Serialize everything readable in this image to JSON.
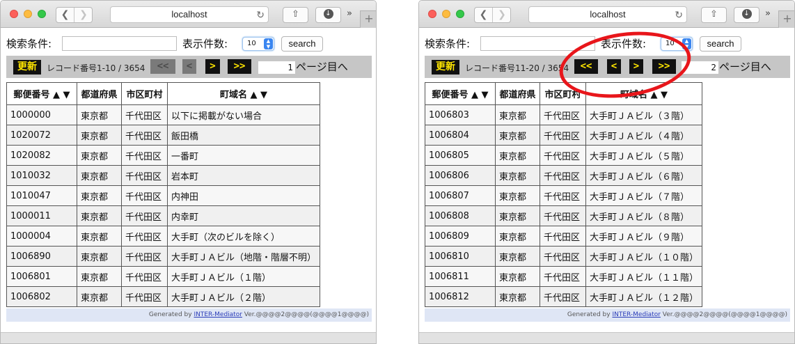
{
  "accent_colors": {
    "button_bg": "#111111",
    "button_text": "#ffe600",
    "annotation": "#e8161b"
  },
  "windows": [
    {
      "browser": {
        "url": "localhost"
      },
      "form": {
        "search_label": "検索条件:",
        "search_value": "",
        "count_label": "表示件数:",
        "count_value": "10",
        "search_button": "search"
      },
      "nav": {
        "update_label": "更新",
        "record_text": "レコード番号1-10 / 3654",
        "first": "<<",
        "prev": "<",
        "next": ">",
        "last": ">>",
        "page_value": "1",
        "page_suffix": "ページ目へ",
        "first_enabled": false,
        "prev_enabled": false
      },
      "table": {
        "headers": [
          "郵便番号 ▲ ▼",
          "都道府県",
          "市区町村",
          "町域名 ▲ ▼"
        ],
        "rows": [
          [
            "1000000",
            "東京都",
            "千代田区",
            "以下に掲載がない場合"
          ],
          [
            "1020072",
            "東京都",
            "千代田区",
            "飯田橋"
          ],
          [
            "1020082",
            "東京都",
            "千代田区",
            "一番町"
          ],
          [
            "1010032",
            "東京都",
            "千代田区",
            "岩本町"
          ],
          [
            "1010047",
            "東京都",
            "千代田区",
            "内神田"
          ],
          [
            "1000011",
            "東京都",
            "千代田区",
            "内幸町"
          ],
          [
            "1000004",
            "東京都",
            "千代田区",
            "大手町（次のビルを除く）"
          ],
          [
            "1006890",
            "東京都",
            "千代田区",
            "大手町ＪＡビル（地階・階層不明）"
          ],
          [
            "1006801",
            "東京都",
            "千代田区",
            "大手町ＪＡビル（１階）"
          ],
          [
            "1006802",
            "東京都",
            "千代田区",
            "大手町ＪＡビル（２階）"
          ]
        ]
      },
      "footer": {
        "prefix": "Generated by ",
        "link": "INTER-Mediator",
        "suffix": " Ver.@@@@2@@@@(@@@@1@@@@)"
      }
    },
    {
      "browser": {
        "url": "localhost"
      },
      "form": {
        "search_label": "検索条件:",
        "search_value": "",
        "count_label": "表示件数:",
        "count_value": "10",
        "search_button": "search"
      },
      "nav": {
        "update_label": "更新",
        "record_text": "レコード番号11-20 / 3654",
        "first": "<<",
        "prev": "<",
        "next": ">",
        "last": ">>",
        "page_value": "2",
        "page_suffix": "ページ目へ",
        "first_enabled": true,
        "prev_enabled": true
      },
      "table": {
        "headers": [
          "郵便番号 ▲ ▼",
          "都道府県",
          "市区町村",
          "町域名 ▲ ▼"
        ],
        "rows": [
          [
            "1006803",
            "東京都",
            "千代田区",
            "大手町ＪＡビル（３階）"
          ],
          [
            "1006804",
            "東京都",
            "千代田区",
            "大手町ＪＡビル（４階）"
          ],
          [
            "1006805",
            "東京都",
            "千代田区",
            "大手町ＪＡビル（５階）"
          ],
          [
            "1006806",
            "東京都",
            "千代田区",
            "大手町ＪＡビル（６階）"
          ],
          [
            "1006807",
            "東京都",
            "千代田区",
            "大手町ＪＡビル（７階）"
          ],
          [
            "1006808",
            "東京都",
            "千代田区",
            "大手町ＪＡビル（８階）"
          ],
          [
            "1006809",
            "東京都",
            "千代田区",
            "大手町ＪＡビル（９階）"
          ],
          [
            "1006810",
            "東京都",
            "千代田区",
            "大手町ＪＡビル（１０階）"
          ],
          [
            "1006811",
            "東京都",
            "千代田区",
            "大手町ＪＡビル（１１階）"
          ],
          [
            "1006812",
            "東京都",
            "千代田区",
            "大手町ＪＡビル（１２階）"
          ]
        ]
      },
      "footer": {
        "prefix": "Generated by ",
        "link": "INTER-Mediator",
        "suffix": " Ver.@@@@2@@@@(@@@@1@@@@)"
      }
    }
  ]
}
